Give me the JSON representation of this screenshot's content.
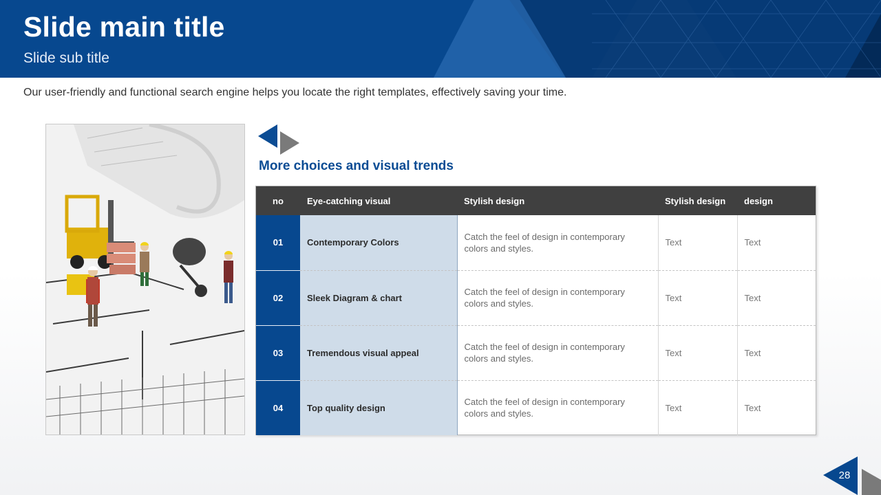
{
  "header": {
    "title": "Slide main title",
    "subtitle": "Slide sub title"
  },
  "intro_text": "Our user-friendly and functional search engine helps you locate the right templates, effectively saving your time.",
  "section": {
    "heading": "More choices and visual trends"
  },
  "table": {
    "columns": [
      "no",
      "Eye-catching visual",
      "Stylish design",
      "Stylish design",
      "design"
    ],
    "rows": [
      {
        "no": "01",
        "visual": "Contemporary Colors",
        "desc": "Catch the feel of design in contemporary colors and styles.",
        "c4": "Text",
        "c5": "Text"
      },
      {
        "no": "02",
        "visual": "Sleek Diagram & chart",
        "desc": "Catch the feel of design in contemporary colors and styles.",
        "c4": "Text",
        "c5": "Text"
      },
      {
        "no": "03",
        "visual": "Tremendous visual appeal",
        "desc": "Catch the feel of design in contemporary colors and styles.",
        "c4": "Text",
        "c5": "Text"
      },
      {
        "no": "04",
        "visual": "Top quality design",
        "desc": "Catch the feel of design in contemporary colors and styles.",
        "c4": "Text",
        "c5": "Text"
      }
    ]
  },
  "page_number": "28",
  "colors": {
    "brand_blue": "#07488f",
    "header_dark": "#404040",
    "light_blue_cell": "#cfdce9",
    "arrow_gray": "#7a7a7a"
  },
  "icons": {
    "heading_mark": "double-triangle-icon",
    "photo": "construction-blueprint-photo"
  }
}
